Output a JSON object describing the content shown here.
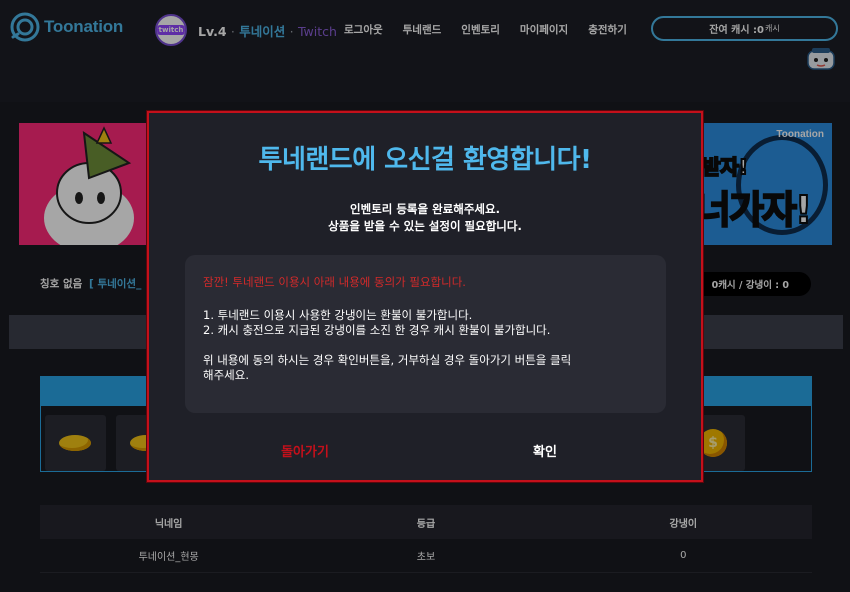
{
  "header": {
    "logo_text": "Toonation",
    "level": "Lv.4",
    "sep1": "·",
    "username": "투네이션",
    "sep2": "·",
    "platform": "Twitch",
    "avatar_badge": "twitch",
    "nav": [
      "로그아웃",
      "투네랜드",
      "인벤토리",
      "마이페이지",
      "충전하기"
    ],
    "cash_label": "잔여 캐시 :0",
    "cash_unit": "캐시"
  },
  "banner": {
    "brand": "Toonation",
    "headline_1": "받자!",
    "headline_2": "너가자!"
  },
  "infobar": {
    "title_label": "칭호 없음",
    "title_user": "[ 투네이션_",
    "stats": "0캐시 / 강냉이 : 0"
  },
  "items": {
    "coin_symbol": "$"
  },
  "table": {
    "headers": [
      "닉네임",
      "등급",
      "강냉이"
    ],
    "rows": [
      [
        "투네이션_현몽",
        "초보",
        "0"
      ]
    ]
  },
  "modal": {
    "title": "투네랜드에 오신걸 환영합니다!",
    "sub_line1": "인벤토리 등록을 완료해주세요.",
    "sub_line2": "상품을 받을 수 있는 설정이 필요합니다.",
    "warning": "잠깐! 투네랜드 이용시 아래 내용에 동의가 필요합니다.",
    "rule1": "1. 투네랜드 이용시 사용한 강냉이는 환불이 불가합니다.",
    "rule2": "2. 캐시 충전으로 지급된 강냉이를 소진 한 경우 캐시 환불이 불가합니다.",
    "agreement_1": "위 내용에 동의 하시는 경우 확인버튼을, 거부하실 경우 돌아가기 버튼을 클릭",
    "agreement_2": "해주세요.",
    "back_button": "돌아가기",
    "ok_button": "확인"
  },
  "colors": {
    "accent": "#4fb8ec",
    "danger": "#c4101b",
    "background": "#1a1b21"
  }
}
